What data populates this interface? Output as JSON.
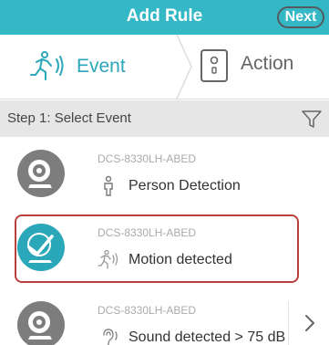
{
  "header": {
    "title": "Add Rule",
    "next_label": "Next"
  },
  "tabs": {
    "event_label": "Event",
    "action_label": "Action"
  },
  "step": {
    "label": "Step 1: Select Event"
  },
  "events": [
    {
      "device": "DCS-8330LH-ABED",
      "label": "Person Detection",
      "icon": "person-icon",
      "selected": false
    },
    {
      "device": "DCS-8330LH-ABED",
      "label": "Motion detected",
      "icon": "motion-icon",
      "selected": true
    },
    {
      "device": "DCS-8330LH-ABED",
      "label": "Sound detected > 75 dB",
      "icon": "ear-icon",
      "selected": false
    }
  ],
  "colors": {
    "accent": "#34b8c6",
    "selected_border": "#b9413c",
    "step_bar": "#e6e6e6"
  }
}
